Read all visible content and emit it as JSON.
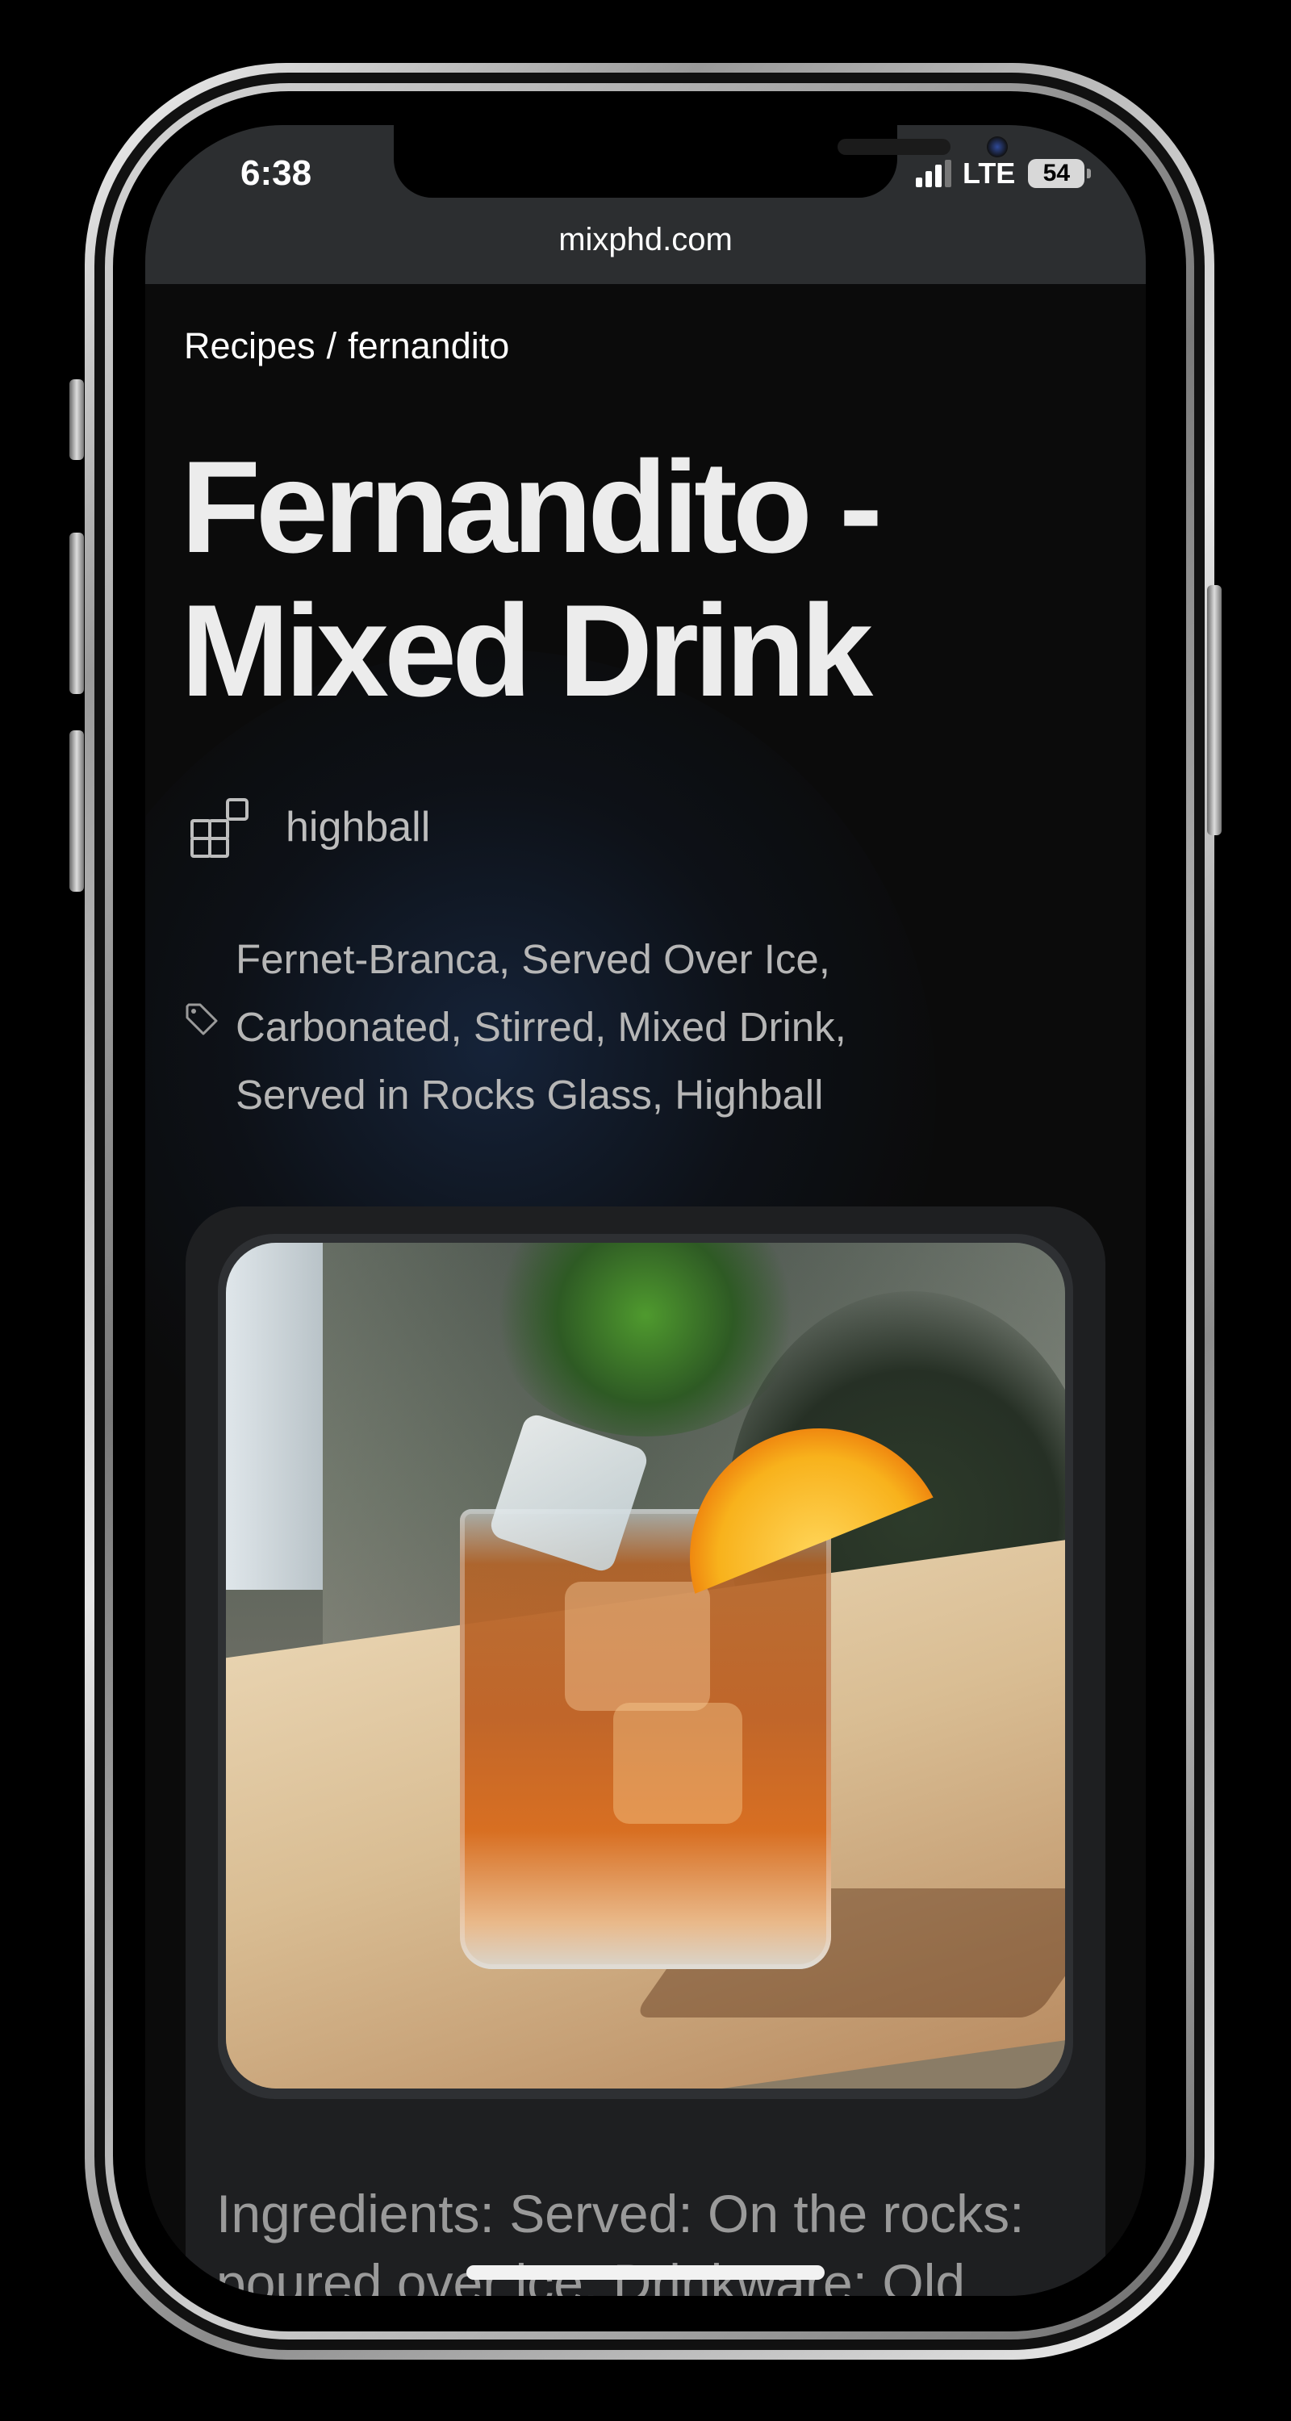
{
  "status_bar": {
    "time": "6:38",
    "network": "LTE",
    "battery": "54",
    "signal_bars": 3
  },
  "browser": {
    "url": "mixphd.com"
  },
  "breadcrumb": {
    "parent": "Recipes",
    "separator": "/",
    "current": "fernandito"
  },
  "recipe": {
    "title": "Fernandito - Mixed Drink",
    "glass_icon": "glass-type-icon",
    "glass": "highball",
    "tag_icon": "tag-icon",
    "tags": "Fernet-Branca, Served Over Ice, Carbonated, Stirred, Mixed Drink, Served in Rocks Glass, Highball",
    "ingredients_line1": "Ingredients: Served: On the rocks:",
    "ingredients_line2": "poured over ice. Drinkware: Old"
  },
  "colors": {
    "background": "#0b0b0b",
    "toolbar": "#2c2e30",
    "card": "#1e1f21",
    "title": "#ececec",
    "muted_text": "#b6b6b6"
  }
}
